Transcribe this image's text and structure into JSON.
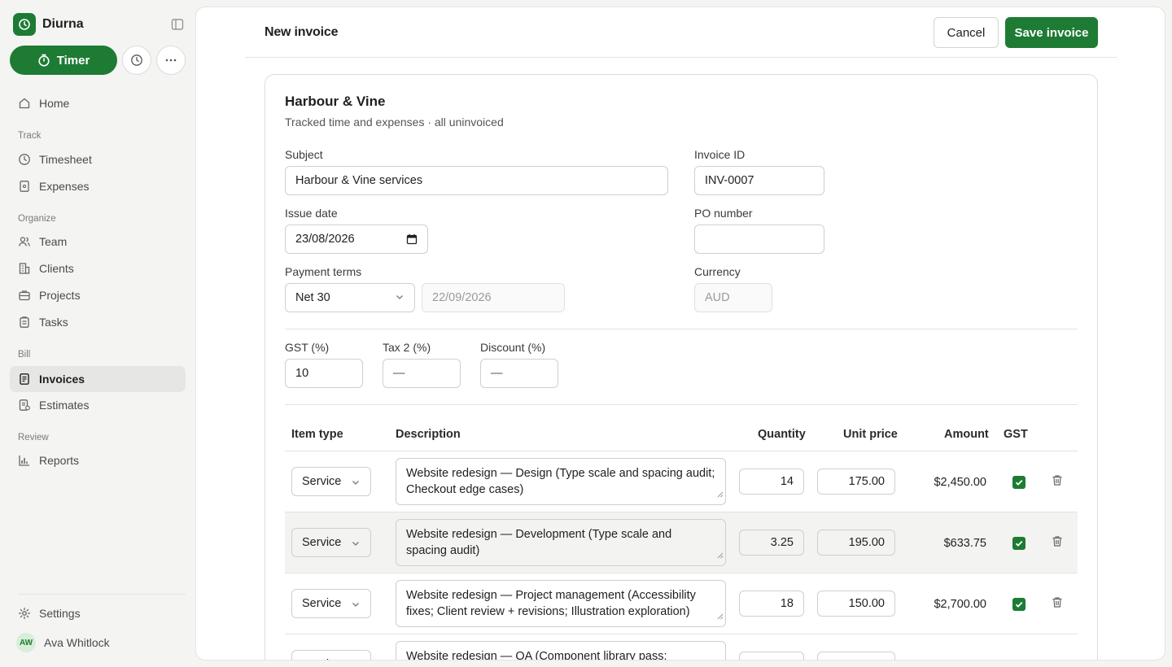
{
  "app": {
    "name": "Diurna"
  },
  "sidebar": {
    "timer_label": "Timer",
    "sections": {
      "track": "Track",
      "organize": "Organize",
      "bill": "Bill",
      "review": "Review"
    },
    "items": {
      "home": "Home",
      "timesheet": "Timesheet",
      "expenses": "Expenses",
      "team": "Team",
      "clients": "Clients",
      "projects": "Projects",
      "tasks": "Tasks",
      "invoices": "Invoices",
      "estimates": "Estimates",
      "reports": "Reports",
      "settings": "Settings"
    },
    "active_item": "invoices",
    "user": {
      "initials": "AW",
      "name": "Ava Whitlock"
    }
  },
  "header": {
    "title": "New invoice",
    "cancel_label": "Cancel",
    "save_label": "Save invoice"
  },
  "client": {
    "name": "Harbour & Vine",
    "subtitle": "Tracked time and expenses · all uninvoiced"
  },
  "form": {
    "subject": {
      "label": "Subject",
      "value": "Harbour & Vine services"
    },
    "invoice_id": {
      "label": "Invoice ID",
      "value": "INV-0007"
    },
    "issue_date": {
      "label": "Issue date",
      "value": "23/08/2026"
    },
    "po_number": {
      "label": "PO number",
      "value": ""
    },
    "payment_terms": {
      "label": "Payment terms",
      "value": "Net 30",
      "due_date": "22/09/2026"
    },
    "currency": {
      "label": "Currency",
      "value": "AUD"
    },
    "gst": {
      "label": "GST (%)",
      "value": "10"
    },
    "tax2": {
      "label": "Tax 2 (%)",
      "value": "—"
    },
    "discount": {
      "label": "Discount (%)",
      "value": "—"
    }
  },
  "table": {
    "headers": {
      "item_type": "Item type",
      "description": "Description",
      "quantity": "Quantity",
      "unit_price": "Unit price",
      "amount": "Amount",
      "gst": "GST"
    },
    "rows": [
      {
        "type": "Service",
        "description": "Website redesign — Design (Type scale and spacing audit; Checkout edge cases)",
        "quantity": "14",
        "unit_price": "175.00",
        "amount": "$2,450.00",
        "gst": true
      },
      {
        "type": "Service",
        "description": "Website redesign — Development (Type scale and spacing audit)",
        "quantity": "3.25",
        "unit_price": "195.00",
        "amount": "$633.75",
        "gst": true
      },
      {
        "type": "Service",
        "description": "Website redesign — Project management (Accessibility fixes; Client review + revisions; Illustration exploration)",
        "quantity": "18",
        "unit_price": "150.00",
        "amount": "$2,700.00",
        "gst": true
      },
      {
        "type": "Service",
        "description": "Website redesign — QA (Component library pass;",
        "quantity": "",
        "unit_price": "",
        "amount": "",
        "gst": true
      }
    ]
  },
  "colors": {
    "brand": "#1e7b34",
    "sidebar_bg": "#f4f4f3",
    "active_item_bg": "#e6e6e4"
  }
}
